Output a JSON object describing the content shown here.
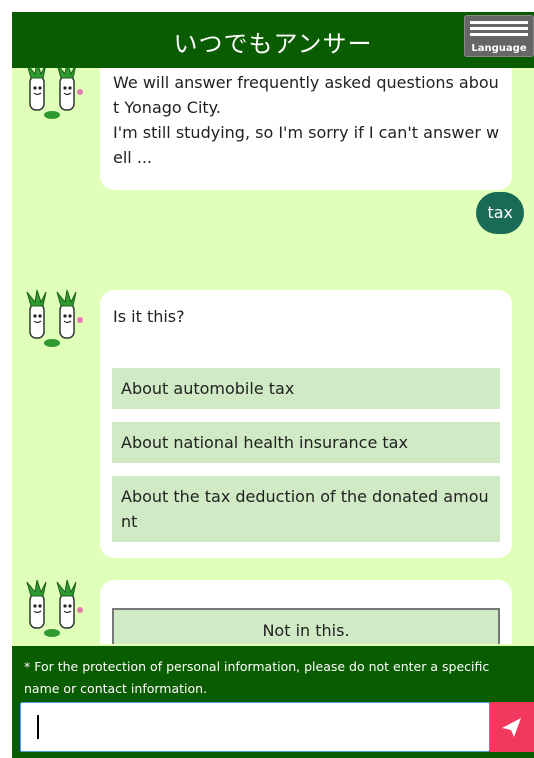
{
  "header": {
    "title": "いつでもアンサー",
    "language_label": "Language"
  },
  "chat": {
    "welcome_text": "We will answer frequently asked questions about Yonago City.\nI'm still studying, so I'm sorry if I can't answer well ...",
    "user_message": "tax",
    "reply": {
      "prompt": "Is it this?",
      "options": [
        "About automobile tax",
        "About national health insurance tax",
        "About the tax deduction of the donated amount"
      ]
    },
    "not_in_this_label": "Not in this."
  },
  "footer": {
    "notice": "* For the protection of personal information, please do not enter a specific name or contact information.",
    "input_value": ""
  },
  "colors": {
    "header_bg": "#0a5c00",
    "chat_bg": "#e0ffb8",
    "user_bubble": "#1a6b55",
    "option_bg": "#cfeac4",
    "send_button": "#f2385f"
  },
  "icons": {
    "avatar": "green-onion-mascot-icon",
    "send": "paper-plane-icon",
    "language": "menu-lines-icon"
  }
}
